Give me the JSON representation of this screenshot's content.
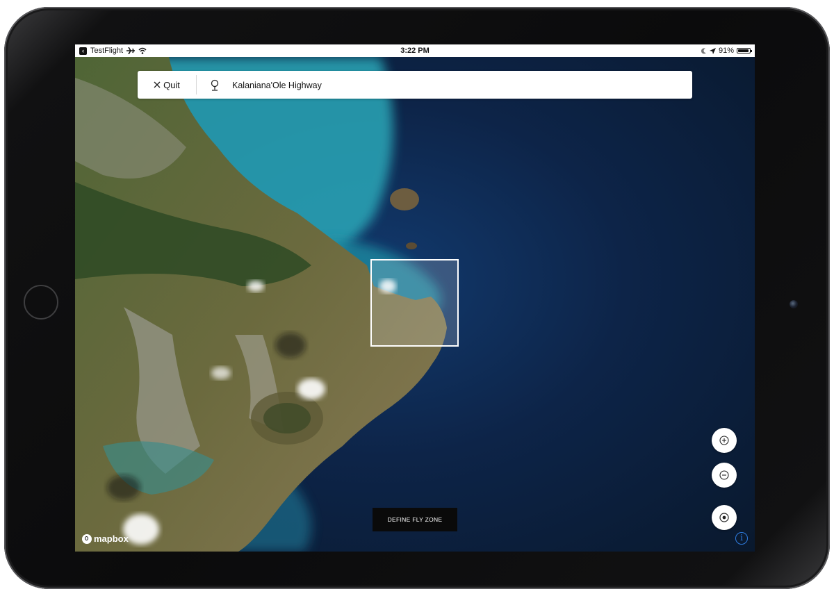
{
  "status_bar": {
    "back_app": "TestFlight",
    "time": "3:22 PM",
    "battery": "91%",
    "battery_level": 0.91,
    "icons": [
      "back-chip-icon",
      "airplane-icon",
      "wifi-icon",
      "moon-icon",
      "location-arrow-icon",
      "battery-icon"
    ]
  },
  "search": {
    "quit_label": "Quit",
    "location_value": "Kalaniana'Ole Highway"
  },
  "map": {
    "provider": "mapbox",
    "controls": [
      "zoom-in-icon",
      "zoom-out-icon",
      "locate-icon",
      "info-icon"
    ]
  },
  "action": {
    "define_fly_zone": "DEFINE FLY ZONE"
  },
  "colors": {
    "ocean_deep": "#0b1e38",
    "ocean_shallow": "#2aa7b8",
    "land": "#5c6a3a",
    "button_dark": "#0a0a0a",
    "info_blue": "#2f7de1"
  }
}
